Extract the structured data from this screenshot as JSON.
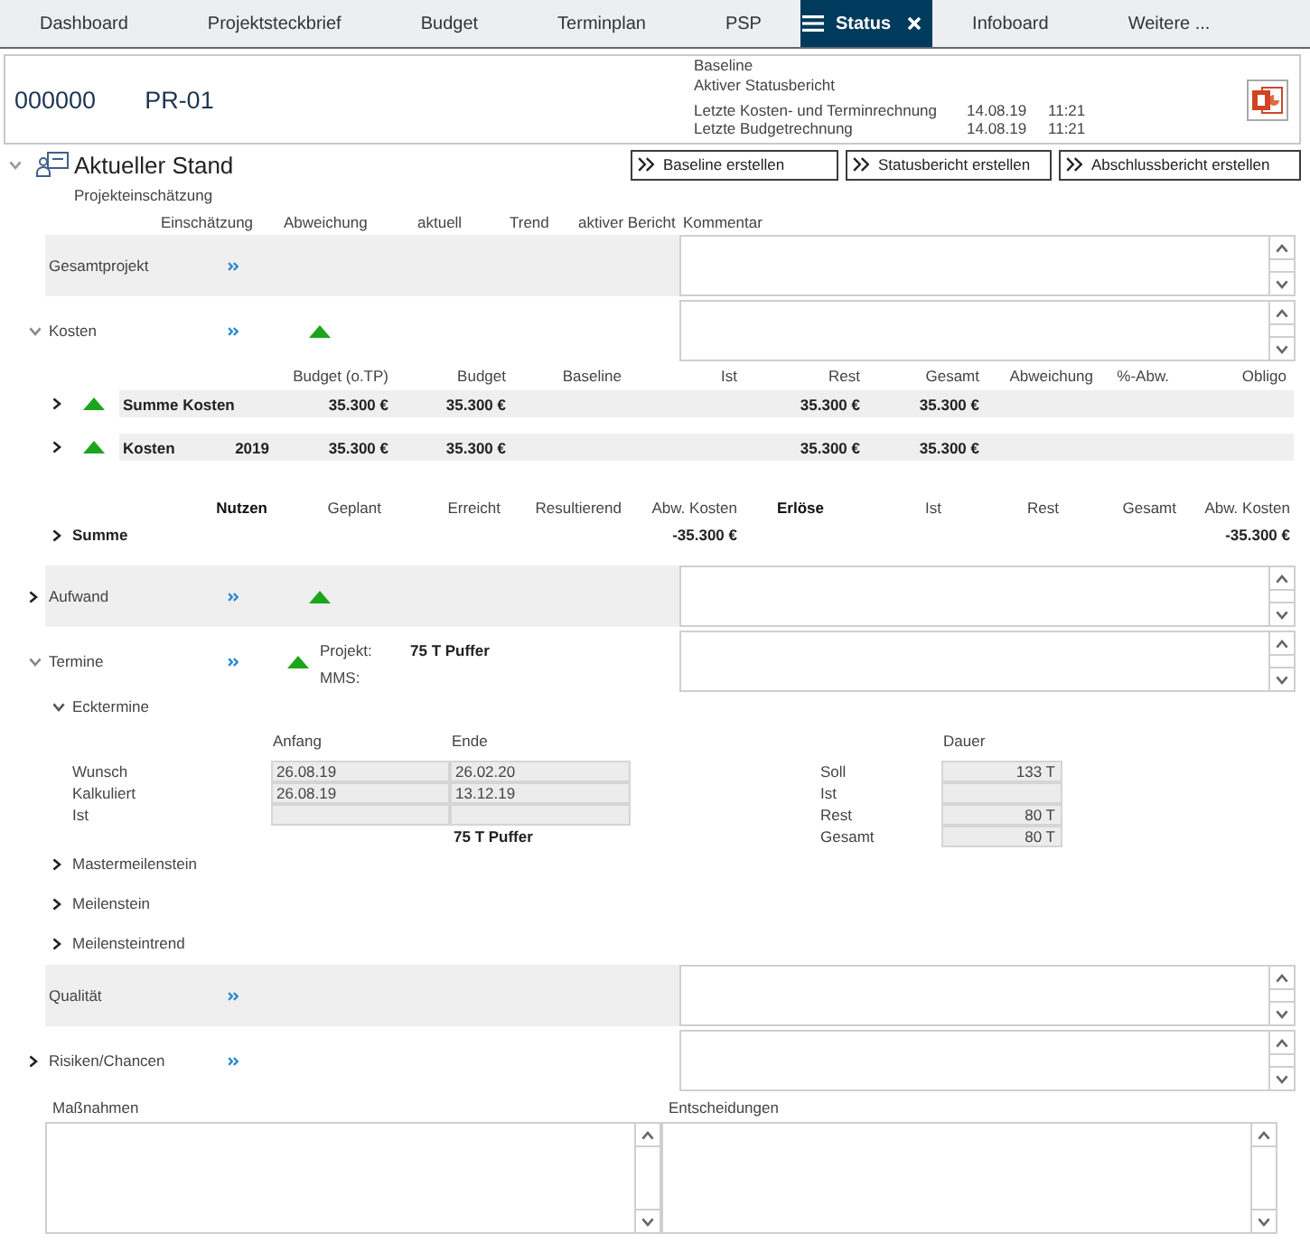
{
  "tabs": [
    {
      "label": "Dashboard",
      "selected": false
    },
    {
      "label": "Projektsteckbrief",
      "selected": false
    },
    {
      "label": "Budget",
      "selected": false
    },
    {
      "label": "Terminplan",
      "selected": false
    },
    {
      "label": "PSP",
      "selected": false
    },
    {
      "label": "Status",
      "selected": true
    },
    {
      "label": "Infoboard",
      "selected": false
    },
    {
      "label": "Weitere ...",
      "selected": false
    }
  ],
  "project": {
    "number": "000000",
    "code": "PR-01",
    "baseline": "Baseline",
    "active_report": "Aktiver Statusbericht",
    "calculations": [
      {
        "label": "Letzte Kosten- und Terminrechnung",
        "date": "14.08.19",
        "time": "11:21"
      },
      {
        "label": "Letzte Budgetrechnung",
        "date": "14.08.19",
        "time": "11:21"
      }
    ]
  },
  "section": {
    "title": "Aktueller Stand",
    "expanded": true,
    "actions": [
      "Baseline erstellen",
      "Statusbericht erstellen",
      "Abschlussbericht erstellen"
    ]
  },
  "assessment": {
    "title": "Projekteinschätzung",
    "columns": [
      "Einschätzung",
      "Abweichung",
      "aktuell",
      "Trend",
      "aktiver Bericht",
      "Kommentar"
    ],
    "areas": [
      {
        "label": "Gesamtprojekt"
      },
      {
        "label": "Kosten",
        "expanded": true,
        "color": "#1ca51c",
        "costs": {
          "columns": [
            {
              "label": "Budget (o.TP)",
              "values": [
                "35.300 €",
                "35.300 €"
              ]
            },
            {
              "label": "Budget",
              "values": [
                "35.300 €",
                "35.300 €"
              ]
            },
            {
              "label": "Baseline"
            },
            {
              "label": "Ist"
            },
            {
              "label": "Rest",
              "values": [
                "35.300 €",
                "35.300 €"
              ]
            },
            {
              "label": "Gesamt",
              "values": [
                "35.300 €",
                "35.300 €"
              ]
            },
            {
              "label": "Abweichung"
            },
            {
              "label": "%-Abw."
            },
            {
              "label": "Obligo"
            }
          ],
          "rows": [
            {
              "label": "Summe Kosten",
              "expanded": false,
              "color": "#1ca51c"
            },
            {
              "label": "Kosten",
              "year": "2019",
              "expanded": false,
              "color": "#1ca51c"
            }
          ]
        },
        "benefits": {
          "groups": [
            {
              "title": "Nutzen",
              "columns": [
                {
                  "label": "Geplant"
                },
                {
                  "label": "Erreicht"
                },
                {
                  "label": "Resultierend"
                },
                {
                  "label": "Abw. Kosten",
                  "values": [
                    "-35.300 €"
                  ]
                }
              ]
            },
            {
              "title": "Erlöse",
              "columns": [
                {
                  "label": "Ist"
                },
                {
                  "label": "Rest"
                },
                {
                  "label": "Gesamt"
                },
                {
                  "label": "Abw. Kosten",
                  "values": [
                    "-35.300 €"
                  ]
                }
              ]
            }
          ],
          "rows": [
            {
              "label": "Summe",
              "expanded": false
            }
          ]
        }
      },
      {
        "label": "Aufwand",
        "expanded": false,
        "color": "#1ca51c"
      },
      {
        "label": "Termine",
        "expanded": true,
        "color": "#1ca51c",
        "details": [
          {
            "label": "Projekt:",
            "value": "75 T Puffer"
          },
          {
            "label": "MMS:"
          }
        ],
        "subsections": [
          {
            "title": "Ecktermine",
            "expanded": true,
            "dates": {
              "columns": [
                {
                  "label": "Anfang",
                  "values": [
                    "26.08.19",
                    "26.08.19"
                  ]
                },
                {
                  "label": "Ende",
                  "values": [
                    "26.02.20",
                    "13.12.19"
                  ]
                }
              ],
              "rows": [
                {
                  "label": "Wunsch"
                },
                {
                  "label": "Kalkuliert"
                },
                {
                  "label": "Ist"
                }
              ],
              "buffer": "75 T Puffer"
            },
            "durations": {
              "title": "Dauer",
              "rows": [
                {
                  "label": "Soll",
                  "value": "133 T"
                },
                {
                  "label": "Ist"
                },
                {
                  "label": "Rest",
                  "value": "80 T"
                },
                {
                  "label": "Gesamt",
                  "value": "80 T"
                }
              ]
            }
          },
          {
            "title": "Mastermeilenstein",
            "expanded": false
          },
          {
            "title": "Meilenstein",
            "expanded": false
          },
          {
            "title": "Meilensteintrend",
            "expanded": false
          }
        ]
      },
      {
        "label": "Qualität"
      },
      {
        "label": "Risiken/Chancen",
        "expanded": false
      }
    ]
  },
  "notes": [
    {
      "label": "Maßnahmen"
    },
    {
      "label": "Entscheidungen"
    }
  ]
}
